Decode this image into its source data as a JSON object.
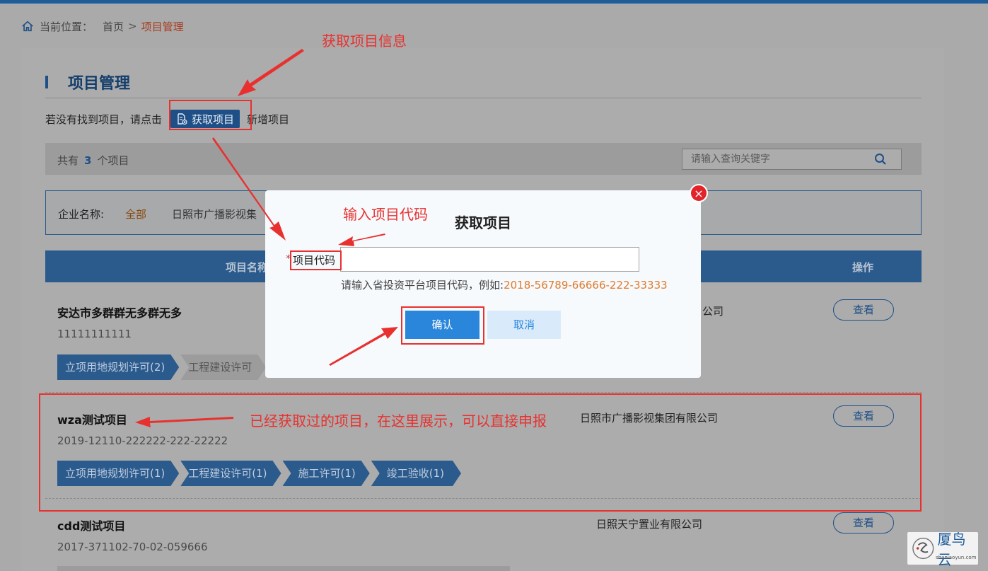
{
  "breadcrumb": {
    "prefix": "当前位置：",
    "home": "首页",
    "separator": ">",
    "current": "项目管理"
  },
  "page": {
    "title": "项目管理",
    "notfound_text": "若没有找到项目，请点击",
    "fetch_button": "获取项目",
    "notfound_suffix": "新增项目"
  },
  "count": {
    "prefix": "共有",
    "value": "3",
    "suffix": "个项目"
  },
  "search": {
    "placeholder": "请输入查询关键字"
  },
  "filter": {
    "label": "企业名称:",
    "all": "全部",
    "company": "日照市广播影视集"
  },
  "table": {
    "col_name": "项目名称",
    "col_op": "操作"
  },
  "projects": [
    {
      "name": "安达市多群群无多群无多",
      "code": "11111111111",
      "company": "公司",
      "view": "查看",
      "steps": [
        "立项用地规划许可(2)",
        "工程建设许可"
      ]
    },
    {
      "name": "wza测试项目",
      "code": "2019-12110-222222-222-22222",
      "company": "日照市广播影视集团有限公司",
      "view": "查看",
      "steps": [
        "立项用地规划许可(1)",
        "工程建设许可(1)",
        "施工许可(1)",
        "竣工验收(1)"
      ]
    },
    {
      "name": "cdd测试项目",
      "code": "2017-371102-70-02-059666",
      "company": "日照天宁置业有限公司",
      "view": "查看",
      "steps": []
    }
  ],
  "modal": {
    "title": "获取项目",
    "close": "×",
    "required_mark": "*",
    "field_label": "项目代码",
    "input_value": "",
    "hint": "请输入省投资平台项目代码，例如:",
    "hint_example": "2018-56789-66666-222-33333",
    "ok": "确认",
    "cancel": "取消"
  },
  "annotations": {
    "fetch_info": "获取项目信息",
    "input_code": "输入项目代码",
    "fetched_note": "已经获取过的项目，在这里展示，可以直接申报"
  },
  "logo": {
    "brand": "厦鸟云",
    "sub": "shaniaoyun.com"
  },
  "colors": {
    "primary": "#1e4f86",
    "accent_red": "#e8312f",
    "ok_button": "#2a86db",
    "example": "#e07a2c"
  }
}
